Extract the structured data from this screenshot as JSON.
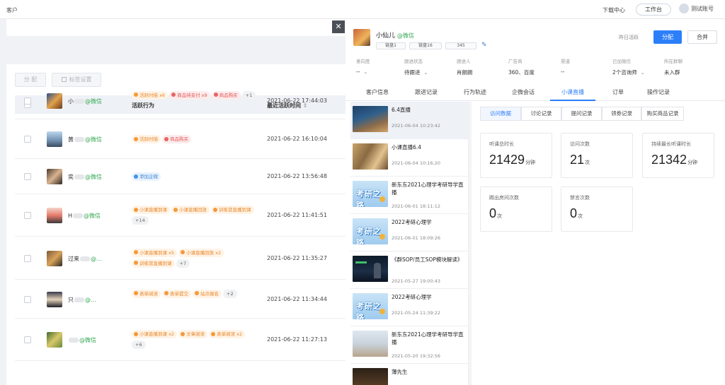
{
  "topbar": {
    "title": "客户",
    "download_center": "下载中心",
    "workspace": "工作台",
    "user_name": "测试账号"
  },
  "toolbar": {
    "assign": "分 配",
    "tag_settings": "标签设置"
  },
  "table": {
    "columns": [
      "客户",
      "活跃行为",
      "最近活跃时间"
    ],
    "rows": [
      {
        "name": "小",
        "wx": "@微信",
        "tags": [
          {
            "text": "活跃时描 x6",
            "c": "orange"
          },
          {
            "text": "商品待支付 x9",
            "c": "red"
          },
          {
            "text": "商品购买",
            "c": "red"
          },
          {
            "text": "+1",
            "c": "gray"
          }
        ],
        "time": "2021-06-22 17:44:03"
      },
      {
        "name": "黄",
        "wx": "@微信",
        "tags": [
          {
            "text": "活跃时描",
            "c": "orange"
          },
          {
            "text": "商品购买",
            "c": "red"
          }
        ],
        "time": "2021-06-22 16:10:04"
      },
      {
        "name": "奕",
        "wx": "@微信",
        "tags": [
          {
            "text": "添加企微",
            "c": "blue"
          }
        ],
        "time": "2021-06-22 13:56:48"
      },
      {
        "name": "H",
        "wx": "@微信",
        "tags": [
          {
            "text": "小课直播到课",
            "c": "orange"
          },
          {
            "text": "小课直播回放",
            "c": "orange"
          },
          {
            "text": "训练营直播到课",
            "c": "orange"
          },
          {
            "text": "+14",
            "c": "gray"
          }
        ],
        "time": "2021-06-22 11:41:51"
      },
      {
        "name": "过来",
        "wx": "@...",
        "tags": [
          {
            "text": "小课直播到课 x5",
            "c": "orange"
          },
          {
            "text": "小课直播回放 x2",
            "c": "orange"
          },
          {
            "text": "训练营直播到课",
            "c": "orange"
          },
          {
            "text": "+7",
            "c": "gray"
          }
        ],
        "time": "2021-06-22 11:35:27"
      },
      {
        "name": "只",
        "wx": "@...",
        "tags": [
          {
            "text": "表单阅读",
            "c": "orange"
          },
          {
            "text": "表单提交",
            "c": "orange"
          },
          {
            "text": "站点报名",
            "c": "orange"
          },
          {
            "text": "+2",
            "c": "gray"
          }
        ],
        "time": "2021-06-22 11:34:44"
      },
      {
        "name": "",
        "wx": "@微信",
        "tags": [
          {
            "text": "小课直播到课 x2",
            "c": "orange"
          },
          {
            "text": "文章阅读",
            "c": "orange"
          },
          {
            "text": "表单阅读 x2",
            "c": "orange"
          },
          {
            "text": "+6",
            "c": "gray"
          }
        ],
        "time": "2021-06-22 11:27:13"
      }
    ]
  },
  "drawer": {
    "close": "✕",
    "name": "小仙儿",
    "wx": "@微信",
    "chips": [
      "链盘1",
      "链盘16",
      "345"
    ],
    "last_active": "昨日活跃",
    "assign_btn": "分配",
    "merge_btn": "合并",
    "info": [
      {
        "label": "意向度",
        "value": "--",
        "caret": true
      },
      {
        "label": "跟进状态",
        "value": "待跟进",
        "caret": true
      },
      {
        "label": "跟进人",
        "value": "肖朗朗"
      },
      {
        "label": "广告商",
        "value": "360、百度"
      },
      {
        "label": "渠道",
        "value": "--"
      },
      {
        "label": "已加微信",
        "value": "2个咨询师",
        "caret": true
      },
      {
        "label": "所在群聊",
        "value": "未入群"
      }
    ],
    "tabs": [
      "客户信息",
      "跟进记录",
      "行为轨迹",
      "企微会话",
      "小课直播",
      "订单",
      "操作记录"
    ],
    "active_tab": "小课直播",
    "lessons": [
      {
        "title": "6.4直播",
        "date": "2021-06-04 10:23:42",
        "thumb": "c1"
      },
      {
        "title": "小课直播6.4",
        "date": "2021-06-04 10:16:20",
        "thumb": "c2"
      },
      {
        "title": "新东东2021心理学考研导学直播",
        "date": "2021-06-01 18:11:12",
        "thumb": "kk"
      },
      {
        "title": "2022考研心理学",
        "date": "2021-06-01 18:09:26",
        "thumb": "kk"
      },
      {
        "title": "《群SOP/员工SOP模块解读》",
        "date": "2021-05-27 19:00:43",
        "thumb": "dark"
      },
      {
        "title": "2022考研心理学",
        "date": "2021-05-24 11:39:22",
        "thumb": "kk"
      },
      {
        "title": "新东东2021心理学考研导学直播",
        "date": "2021-05-20 19:32:56",
        "thumb": "bld"
      },
      {
        "title": "薄先生",
        "date": "",
        "thumb": "drk2"
      }
    ],
    "kaoyan_text": "考研之路",
    "sub_tabs": [
      "访问数据",
      "讨论记录",
      "提问记录",
      "领券记录",
      "购买商品记录"
    ],
    "stats": [
      {
        "label": "听课总时长",
        "value": "21429",
        "unit": "分钟"
      },
      {
        "label": "访问次数",
        "value": "21",
        "unit": "次"
      },
      {
        "label": "持续最长听课时长",
        "value": "21342",
        "unit": "分钟"
      },
      {
        "label": "踢出房间次数",
        "value": "0",
        "unit": "次"
      },
      {
        "label": "禁言次数",
        "value": "0",
        "unit": "次"
      }
    ]
  }
}
